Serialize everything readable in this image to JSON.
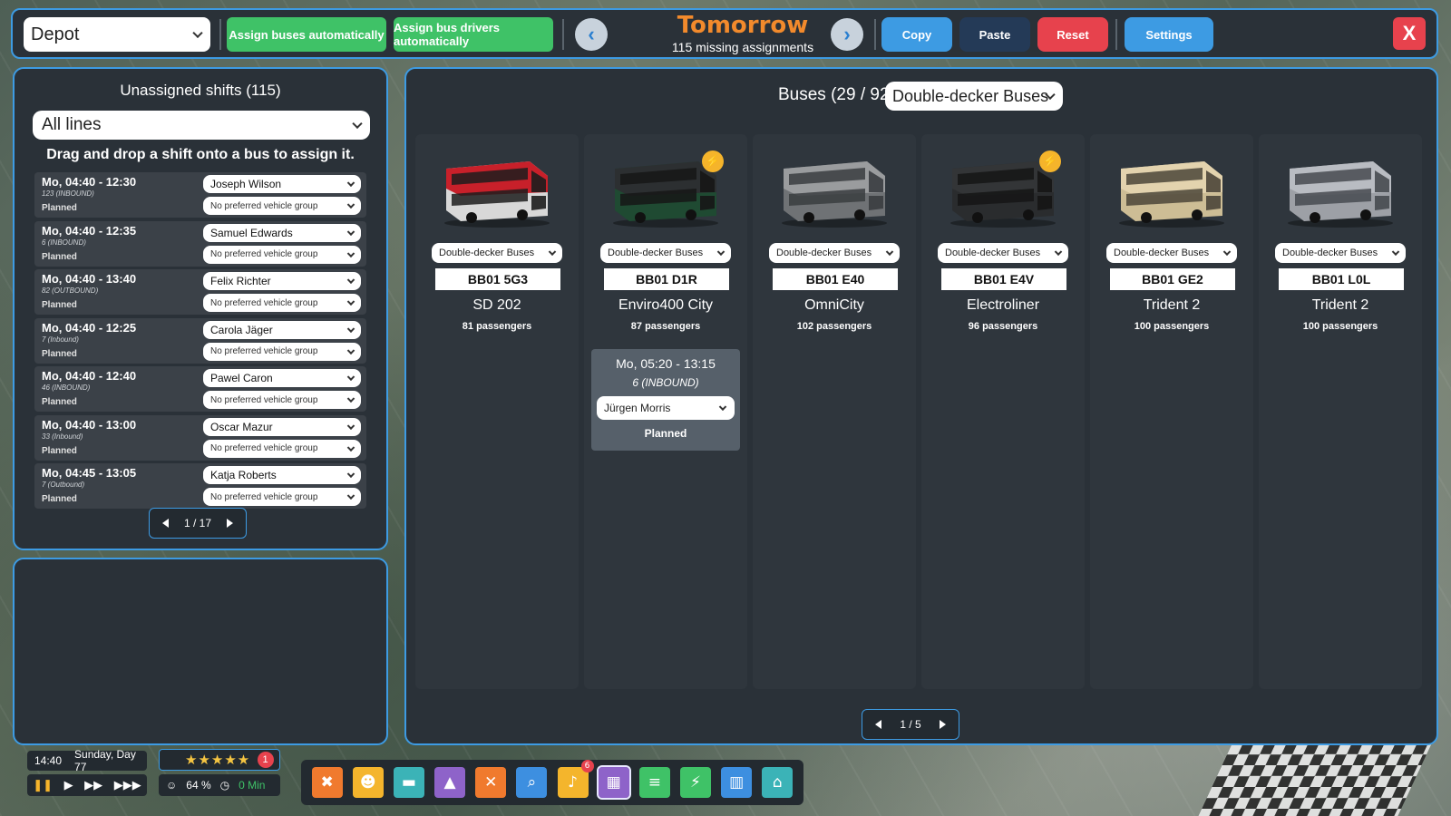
{
  "header": {
    "depot_label": "Depot",
    "assign_buses_label": "Assign buses automatically",
    "assign_drivers_label": "Assign bus drivers automatically",
    "day_title": "Tomorrow",
    "missing_assignments": "115 missing assignments",
    "copy_label": "Copy",
    "paste_label": "Paste",
    "reset_label": "Reset",
    "settings_label": "Settings",
    "close_label": "X",
    "colors": {
      "copy": "#3d9be3",
      "paste": "#243a57",
      "reset": "#e7424d",
      "settings": "#3d9be3",
      "green": "#3fc267",
      "day_title": "#f28a2c"
    }
  },
  "shifts_panel": {
    "title": "Unassigned shifts (115)",
    "filter": "All lines",
    "hint": "Drag and drop a shift onto a bus to assign it.",
    "pager": "1 / 17",
    "shifts": [
      {
        "time": "Mo, 04:40 - 12:30",
        "line": "123 (INBOUND)",
        "status": "Planned",
        "driver": "Joseph Wilson",
        "group": "No preferred vehicle group"
      },
      {
        "time": "Mo, 04:40 - 12:35",
        "line": "6 (INBOUND)",
        "status": "Planned",
        "driver": "Samuel Edwards",
        "group": "No preferred vehicle group"
      },
      {
        "time": "Mo, 04:40 - 13:40",
        "line": "82 (OUTBOUND)",
        "status": "Planned",
        "driver": "Felix Richter",
        "group": "No preferred vehicle group"
      },
      {
        "time": "Mo, 04:40 - 12:25",
        "line": "7 (Inbound)",
        "status": "Planned",
        "driver": "Carola Jäger",
        "group": "No preferred vehicle group"
      },
      {
        "time": "Mo, 04:40 - 12:40",
        "line": "46 (INBOUND)",
        "status": "Planned",
        "driver": "Pawel Caron",
        "group": "No preferred vehicle group"
      },
      {
        "time": "Mo, 04:40 - 13:00",
        "line": "33 (Inbound)",
        "status": "Planned",
        "driver": "Oscar Mazur",
        "group": "No preferred vehicle group"
      },
      {
        "time": "Mo, 04:45 - 13:05",
        "line": "7 (Outbound)",
        "status": "Planned",
        "driver": "Katja Roberts",
        "group": "No preferred vehicle group"
      }
    ]
  },
  "buses_panel": {
    "title": "Buses (29 / 92)",
    "type_filter": "Double-decker Buses",
    "pager": "1 / 5",
    "buses": [
      {
        "group": "Double-decker Buses",
        "plate": "BB01 5G3",
        "model": "SD 202",
        "passengers": "81 passengers",
        "electric": false,
        "colors": {
          "upper": "#c8202a",
          "lower": "#d8d8d8",
          "stripe": "#1d1d1d"
        }
      },
      {
        "group": "Double-decker Buses",
        "plate": "BB01 D1R",
        "model": "Enviro400 City",
        "passengers": "87 passengers",
        "electric": true,
        "colors": {
          "upper": "#2c2f31",
          "lower": "#1f4a32",
          "stripe": "#161616"
        }
      },
      {
        "group": "Double-decker Buses",
        "plate": "BB01 E40",
        "model": "OmniCity",
        "passengers": "102 passengers",
        "electric": false,
        "colors": {
          "upper": "#9a9c9e",
          "lower": "#6f7275",
          "stripe": "#3a3d40"
        }
      },
      {
        "group": "Double-decker Buses",
        "plate": "BB01 E4V",
        "model": "Electroliner",
        "passengers": "96 passengers",
        "electric": true,
        "colors": {
          "upper": "#333537",
          "lower": "#2a2c2e",
          "stripe": "#151515"
        }
      },
      {
        "group": "Double-decker Buses",
        "plate": "BB01 GE2",
        "model": "Trident 2",
        "passengers": "100 passengers",
        "electric": false,
        "colors": {
          "upper": "#e3d3ae",
          "lower": "#cdbd95",
          "stripe": "#4b4538"
        }
      },
      {
        "group": "Double-decker Buses",
        "plate": "BB01 L0L",
        "model": "Trident 2",
        "passengers": "100 passengers",
        "electric": false,
        "colors": {
          "upper": "#b9bcc2",
          "lower": "#9da0a6",
          "stripe": "#474a50"
        }
      }
    ],
    "assigned_shift": {
      "time": "Mo, 05:20 - 13:15",
      "line": "6 (INBOUND)",
      "driver": "Jürgen Morris",
      "status": "Planned"
    }
  },
  "hud": {
    "time": "14:40",
    "date": "Sunday, Day 77",
    "rating_badge": "1",
    "satisfaction": "64 %",
    "wait": "0 Min",
    "notification_count": "6",
    "tools": [
      {
        "icon": "tools-icon",
        "glyph": "✖",
        "color": "#f07a2e"
      },
      {
        "icon": "staff-icon",
        "glyph": "☻",
        "color": "#f4b52c"
      },
      {
        "icon": "bus-icon",
        "glyph": "▬",
        "color": "#3bb3b7"
      },
      {
        "icon": "chart-icon",
        "glyph": "▲",
        "color": "#8e63c9"
      },
      {
        "icon": "cancel-icon",
        "glyph": "✕",
        "color": "#f07a2e"
      },
      {
        "icon": "search-icon",
        "glyph": "⌕",
        "color": "#3d8fe0"
      },
      {
        "icon": "bell-icon",
        "glyph": "♪",
        "color": "#f4b52c"
      },
      {
        "icon": "calendar-icon",
        "glyph": "▦",
        "color": "#8e63c9"
      },
      {
        "icon": "document-icon",
        "glyph": "≡",
        "color": "#3fc267"
      },
      {
        "icon": "lightning-icon",
        "glyph": "⚡",
        "color": "#3fc267"
      },
      {
        "icon": "building-icon",
        "glyph": "▥",
        "color": "#3d8fe0"
      },
      {
        "icon": "depot-icon",
        "glyph": "⌂",
        "color": "#3bb3b7"
      }
    ]
  }
}
